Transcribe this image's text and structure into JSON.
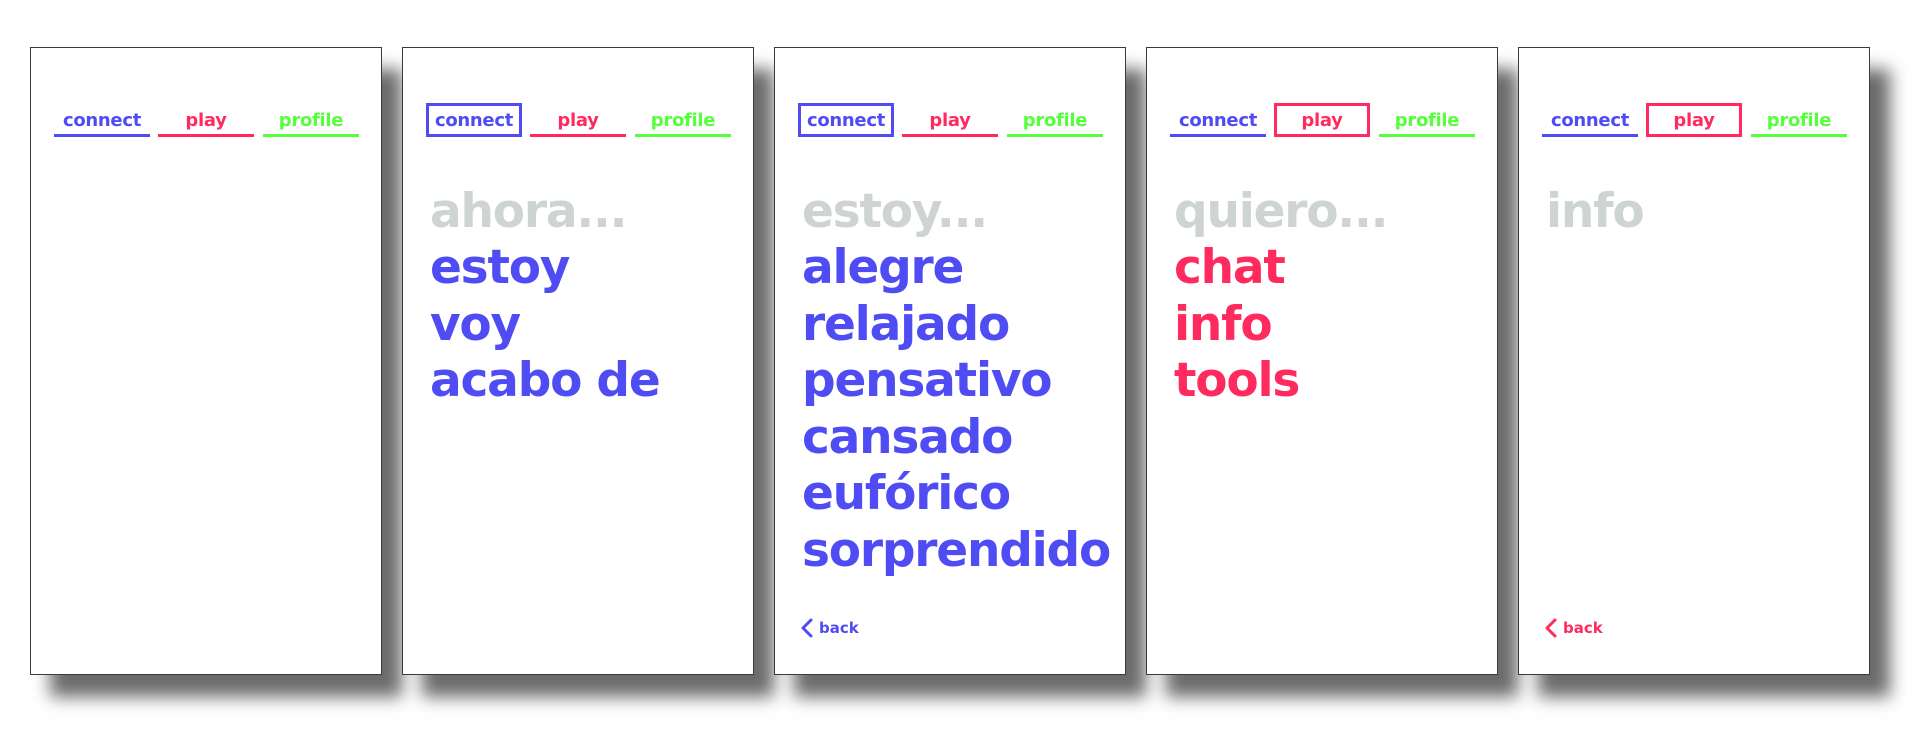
{
  "colors": {
    "connect": "#4f4cf4",
    "play": "#ff2b5e",
    "profile": "#55ff3c",
    "heading_gray": "#cdd4d2"
  },
  "tabs": {
    "connect": "connect",
    "play": "play",
    "profile": "profile"
  },
  "screens": [
    {
      "active_tab": "",
      "heading": "",
      "options": [],
      "back": ""
    },
    {
      "active_tab": "connect",
      "heading": "ahora...",
      "options": [
        "estoy",
        "voy",
        "acabo de"
      ],
      "back": ""
    },
    {
      "active_tab": "connect",
      "heading": "estoy...",
      "options": [
        "alegre",
        "relajado",
        "pensativo",
        "cansado",
        "eufórico",
        "sorprendido"
      ],
      "back": "back"
    },
    {
      "active_tab": "play",
      "heading": "quiero...",
      "options": [
        "chat",
        "info",
        "tools"
      ],
      "back": ""
    },
    {
      "active_tab": "play",
      "heading": "info",
      "options": [],
      "back": "back"
    }
  ]
}
